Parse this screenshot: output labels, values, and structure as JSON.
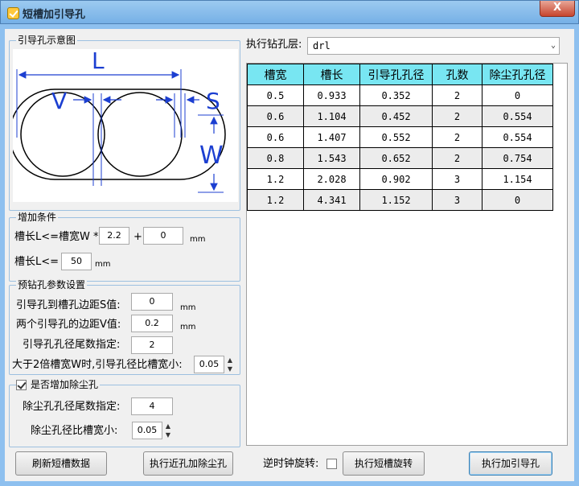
{
  "window": {
    "title": "短槽加引导孔",
    "close_symbol": "X"
  },
  "diagram": {
    "legend": "引导孔示意图",
    "labels": {
      "L": "L",
      "V": "V",
      "S": "S",
      "W": "W"
    }
  },
  "conditions": {
    "legend": "增加条件",
    "length_formula_label": "槽长L<=槽宽W *",
    "multiplier": "2.2",
    "plus": "+",
    "offset": "0",
    "unit1": "mm",
    "max_length_label": "槽长L<=",
    "max_length": "50",
    "unit2": "mm"
  },
  "predrill": {
    "legend": "预钻孔参数设置",
    "s_label": "引导孔到槽孔边距S值:",
    "s_value": "0",
    "s_unit": "mm",
    "v_label": "两个引导孔的边距V值:",
    "v_value": "0.2",
    "v_unit": "mm",
    "tail_label": "引导孔孔径尾数指定:",
    "tail_value": "2",
    "smaller_label": "大于2倍槽宽W时,引导孔径比槽宽小:",
    "smaller_value": "0.05"
  },
  "dust": {
    "legend": "是否增加除尘孔",
    "checked": true,
    "tail_label": "除尘孔孔径尾数指定:",
    "tail_value": "4",
    "smaller_label": "除尘孔径比槽宽小:",
    "smaller_value": "0.05"
  },
  "layer": {
    "label": "执行钻孔层:",
    "value": "drl"
  },
  "table": {
    "headers": [
      "槽宽",
      "槽长",
      "引导孔孔径",
      "孔数",
      "除尘孔孔径"
    ],
    "rows": [
      [
        "0.5",
        "0.933",
        "0.352",
        "2",
        "0"
      ],
      [
        "0.6",
        "1.104",
        "0.452",
        "2",
        "0.554"
      ],
      [
        "0.6",
        "1.407",
        "0.552",
        "2",
        "0.554"
      ],
      [
        "0.8",
        "1.543",
        "0.652",
        "2",
        "0.754"
      ],
      [
        "1.2",
        "2.028",
        "0.902",
        "3",
        "1.154"
      ],
      [
        "1.2",
        "4.341",
        "1.152",
        "3",
        "0"
      ]
    ]
  },
  "bottom": {
    "refresh_label": "刷新短槽数据",
    "near_hole_label": "执行近孔加除尘孔",
    "ccw_label": "逆时钟旋转:",
    "ccw_checked": false,
    "rotate_label": "执行短槽旋转",
    "guide_label": "执行加引导孔"
  },
  "icons": {
    "up": "▲",
    "down": "▼",
    "dropdown": "⌄"
  }
}
